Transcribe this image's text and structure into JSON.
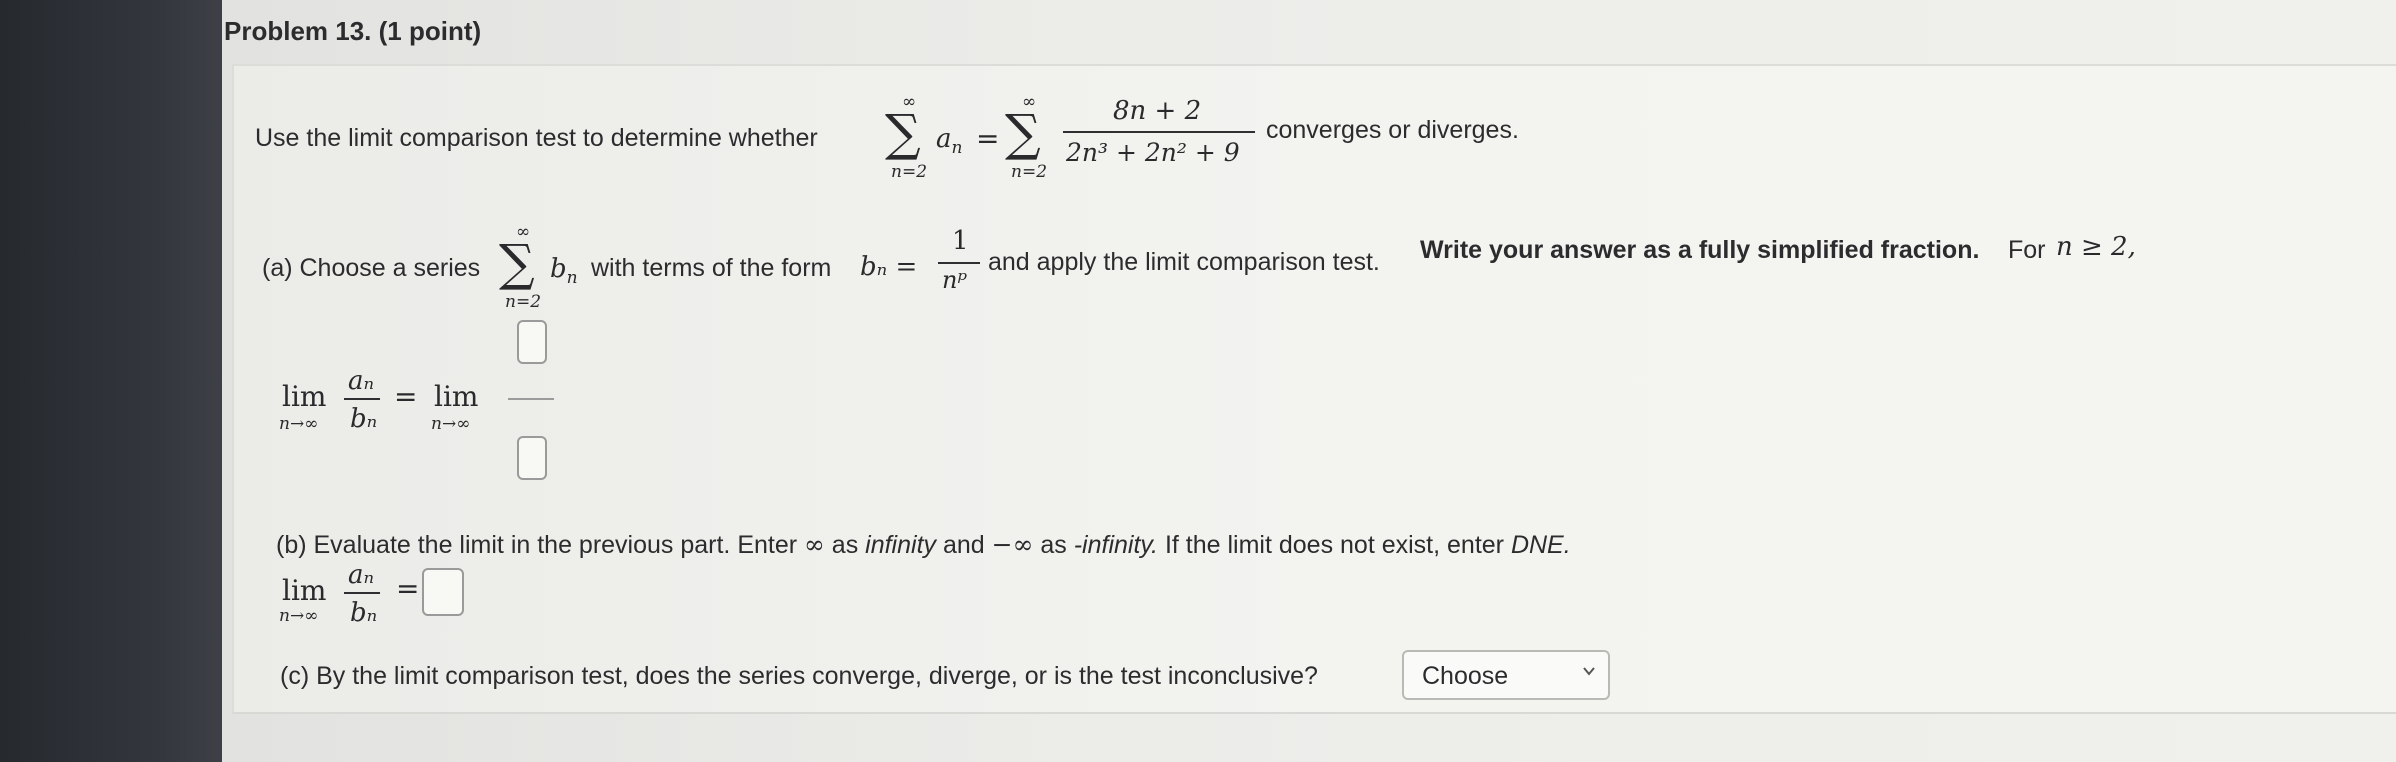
{
  "problem": {
    "title": "Problem 13. (1 point)",
    "intro_text": "Use the limit comparison test to determine whether",
    "intro_text_end": "converges or diverges.",
    "series": {
      "sum_upper": "∞",
      "sum_lower": "n=2",
      "term": "a",
      "term_sub": "n",
      "equals": "=",
      "numerator": "8n + 2",
      "denominator": "2n³ + 2n² + 9"
    }
  },
  "part_a": {
    "label": "(a) Choose a series",
    "sum_upper": "∞",
    "sum_lower": "n=2",
    "b_term": "b",
    "b_sub": "n",
    "text_mid": "with terms of the form",
    "bn_lhs": "bₙ =",
    "bn_num": "1",
    "bn_den": "nᵖ",
    "text_end": "and apply the limit comparison test.",
    "bold_text": "Write your answer as a fully simplified fraction.",
    "condition_text": "For",
    "condition_math": "n ≥ 2,",
    "lim_word": "lim",
    "lim_sub": "n→∞",
    "ratio_num": "aₙ",
    "ratio_den": "bₙ",
    "equals": "="
  },
  "part_b": {
    "text1": "(b) Evaluate the limit in the previous part. Enter ",
    "inf_symbol": "∞",
    "text2": " as ",
    "inf_word": "infinity",
    "text3": " and ",
    "neg_inf_symbol": "−∞",
    "text4": " as ",
    "neg_inf_word": "-infinity.",
    "text5": " If the limit does not exist, enter ",
    "dne": "DNE.",
    "lim_word": "lim",
    "lim_sub": "n→∞",
    "ratio_num": "aₙ",
    "ratio_den": "bₙ",
    "equals": "="
  },
  "part_c": {
    "question": "(c) By the limit comparison test, does the series converge, diverge, or is the test inconclusive?",
    "select_value": "Choose"
  }
}
